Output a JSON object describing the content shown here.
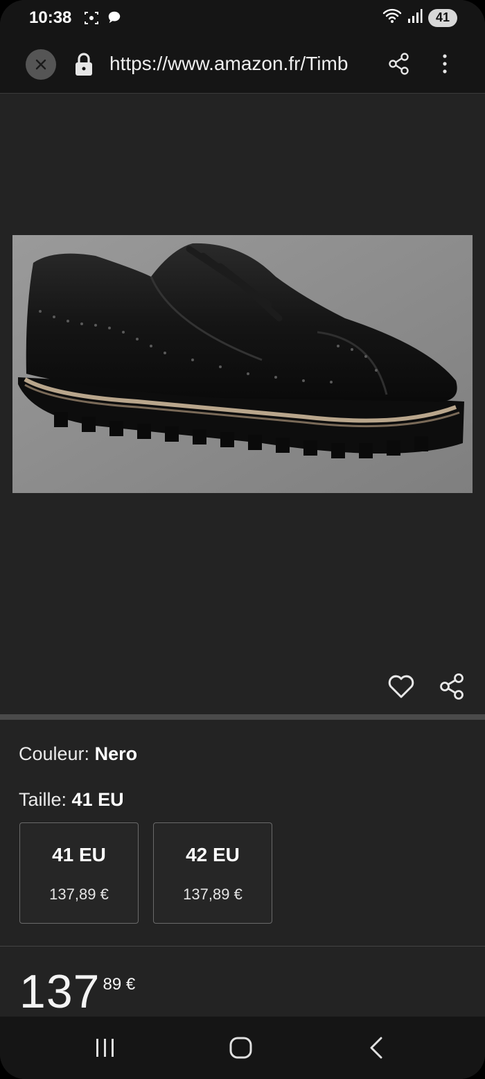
{
  "status_bar": {
    "time": "10:38",
    "battery_level": "41",
    "icons": [
      "screenshot-icon",
      "chat-bubble-icon",
      "wifi-icon",
      "signal-icon"
    ]
  },
  "browser": {
    "url": "https://www.amazon.fr/Timb",
    "icons": [
      "close-icon",
      "lock-icon",
      "share-icon",
      "more-vert-icon"
    ]
  },
  "product": {
    "image_icons": [
      "heart-icon",
      "share-icon"
    ],
    "color_label": "Couleur:",
    "color_value": "Nero",
    "size_label": "Taille:",
    "size_value": "41 EU",
    "sizes": [
      {
        "size": "41 EU",
        "price": "137,89 €"
      },
      {
        "size": "42 EU",
        "price": "137,89 €"
      }
    ],
    "price_whole": "137",
    "price_fraction": "89 €"
  },
  "nav": {
    "icons": [
      "recent-apps-icon",
      "home-icon",
      "back-icon"
    ]
  },
  "colors": {
    "background": "#232323",
    "bars": "#151515"
  }
}
